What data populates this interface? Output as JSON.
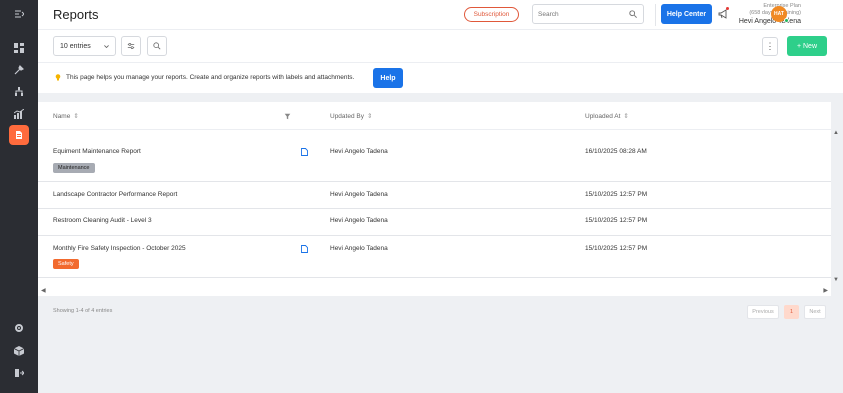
{
  "header": {
    "title": "Reports",
    "subscription_label": "Subscription",
    "search_placeholder": "Search",
    "help_center_label": "Help Center",
    "plan_line1": "Enterprise Plan",
    "plan_line2": "(658 days remaining)",
    "user_name": "Hevi Angelo Tadena",
    "avatar_initials": "HAT"
  },
  "toolbar": {
    "entries_label": "10 entries",
    "kebab_label": "⋮",
    "new_label": "+ New"
  },
  "info": {
    "text": "This page helps you manage your reports. Create and organize reports with labels and attachments.",
    "help_label": "Help"
  },
  "table": {
    "columns": [
      "Name",
      "Updated By",
      "Uploaded At"
    ],
    "sort_glyph": "⇕",
    "rows": [
      {
        "name": "Equiment Maintenance Report",
        "updated_by": "Hevi Angelo Tadena",
        "uploaded_at": "16/10/2025 08:28 AM",
        "badge": "Maintenance"
      },
      {
        "name": "Landscape Contractor Performance Report",
        "updated_by": "Hevi Angelo Tadena",
        "uploaded_at": "15/10/2025 12:57 PM"
      },
      {
        "name": "Restroom Cleaning Audit - Level 3",
        "updated_by": "Hevi Angelo Tadena",
        "uploaded_at": "15/10/2025 12:57 PM"
      },
      {
        "name": "Monthly Fire Safety Inspection - October 2025",
        "updated_by": "Hevi Angelo Tadena",
        "uploaded_at": "15/10/2025 12:57 PM",
        "badge": "Safety"
      }
    ]
  },
  "footer": {
    "showing": "Showing 1-4 of 4 entries",
    "prev": "Previous",
    "page": "1",
    "next": "Next"
  },
  "colors": {
    "accent": "#1a73e8",
    "brand": "#ff6b3d",
    "new_button": "#2ecf8a",
    "sidebar": "#2b2d33"
  },
  "icons": {
    "sidebar_top": [
      "expand-icon",
      "dashboard-icon",
      "tools-icon",
      "org-chart-icon",
      "analytics-icon",
      "reports-icon"
    ],
    "sidebar_bottom": [
      "settings-icon",
      "package-icon",
      "logout-icon"
    ]
  }
}
